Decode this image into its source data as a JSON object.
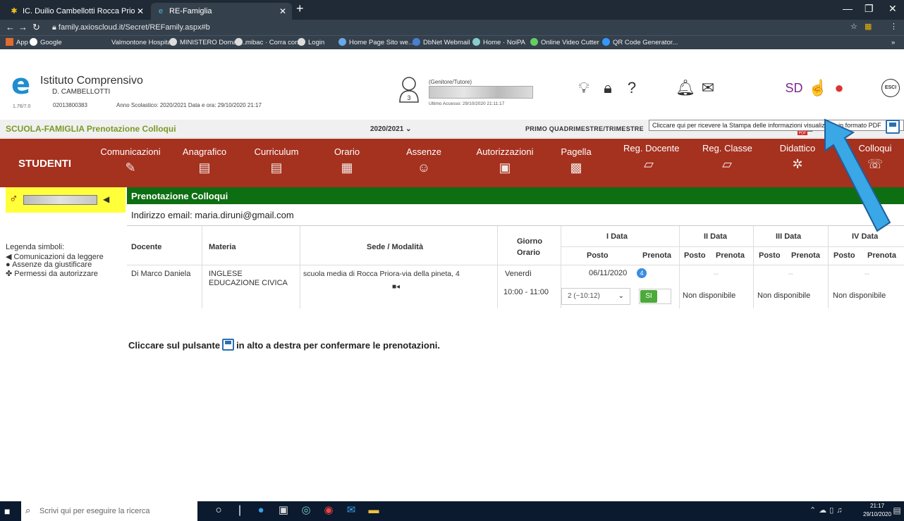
{
  "browser": {
    "tabs": [
      {
        "title": "IC. Duilio Cambellotti Rocca Prio",
        "icon": "star-icon"
      },
      {
        "title": "RE-Famiglia",
        "icon": "re-logo-icon"
      }
    ],
    "url": "family.axioscloud.it/Secret/REFamily.aspx#b",
    "bookmarks": [
      "App",
      "Google",
      "Valmontone Hospital",
      "MINISTERO Doman...",
      "mibac · Corra con...",
      "Login",
      "Home Page Sito we...",
      "DbNet Webmail",
      "Home · NoiPA",
      "Online Video Cutter",
      "QR Code Generator..."
    ]
  },
  "header": {
    "institute_name": "Istituto Comprensivo",
    "institute_sub": "D. CAMBELLOTTI",
    "version": "1.76/7.0",
    "code": "02013800383",
    "school_year_info": "Anno Scolastico: 2020/2021   Data e ora: 29/10/2020 21:17",
    "role": "(Genitore/Tutore)",
    "last_access": "Ultimo Accesso: 29/10/2020 21:11:17",
    "avatar_number": "3",
    "right_badges": [
      "SD",
      "ESCI"
    ]
  },
  "titlebar": {
    "title": "SCUOLA-FAMIGLIA Prenotazione Colloqui",
    "year": "2020/2021",
    "period": "PRIMO QUADRIMESTRE/TRIMESTRE",
    "tooltip": "Cliccare qui per ricevere la Stampa delle informazioni visualizzate in formato PDF"
  },
  "nav": {
    "section": "STUDENTI",
    "items": [
      "Comunicazioni",
      "Anagrafico",
      "Curriculum",
      "Orario",
      "Assenze",
      "Autorizzazioni",
      "Pagella",
      "Reg. Docente",
      "Reg. Classe",
      "Didattico",
      "Colloqui"
    ]
  },
  "sidebar": {
    "legend_title": "Legenda simboli:",
    "legend": [
      "Comunicazioni da leggere",
      "Assenze da giustificare",
      "Permessi da autorizzare"
    ]
  },
  "main": {
    "title": "Prenotazione Colloqui",
    "email": "Indirizzo email: maria.diruni@gmail.com",
    "table": {
      "headers": {
        "docente": "Docente",
        "materia": "Materia",
        "sede": "Sede / Modalità",
        "giorno": "Giorno",
        "orario": "Orario",
        "data1": "I Data",
        "data2": "II Data",
        "data3": "III Data",
        "data4": "IV Data",
        "posto": "Posto",
        "prenota": "Prenota"
      },
      "row": {
        "docente": "Di Marco Daniela",
        "materia1": "INGLESE",
        "materia2": "EDUCAZIONE CIVICA",
        "sede": "scuola media di Rocca Priora-via della pineta, 4",
        "giorno": "Venerdì",
        "orario": "10:00 - 11:00",
        "data1": "06/11/2020",
        "badge": "4",
        "posto_select": "2 (~10:12)",
        "si": "SI",
        "dash": "--",
        "non_disp": "Non disponibile"
      }
    },
    "confirm_before": "Cliccare sul pulsante",
    "confirm_after": "in alto a destra per confermare le prenotazioni."
  },
  "taskbar": {
    "search_placeholder": "Scrivi qui per eseguire la ricerca",
    "time": "21:17",
    "date": "29/10/2020"
  }
}
